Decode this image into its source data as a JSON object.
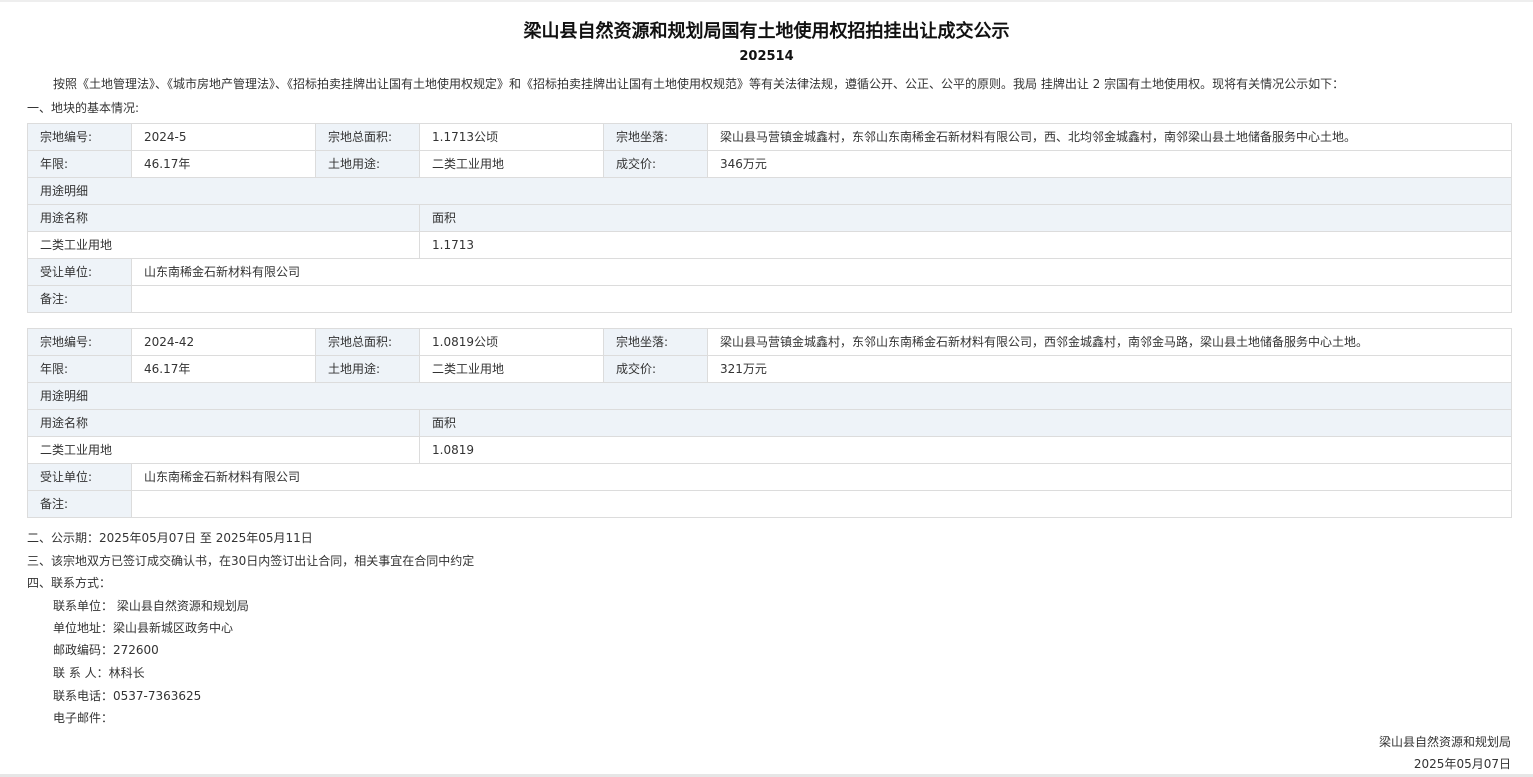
{
  "title": "梁山县自然资源和规划局国有土地使用权招拍挂出让成交公示",
  "number": "202514",
  "intro": "按照《土地管理法》、《城市房地产管理法》、《招标拍卖挂牌出让国有土地使用权规定》和《招标拍卖挂牌出让国有土地使用权规范》等有关法律法规，遵循公开、公正、公平的原则。我局 挂牌出让 2 宗国有土地使用权。现将有关情况公示如下：",
  "section1": "一、地块的基本情况:",
  "labels": {
    "parcel_no": "宗地编号:",
    "total_area": "宗地总面积:",
    "location": "宗地坐落:",
    "term": "年限:",
    "usage": "土地用途:",
    "price": "成交价:",
    "usage_detail": "用途明细",
    "usage_name": "用途名称",
    "area": "面积",
    "transferee": "受让单位:",
    "remarks": "备注:"
  },
  "parcels": [
    {
      "parcel_no": "2024-5",
      "total_area": "1.1713公顷",
      "location": "梁山县马营镇金城鑫村，东邻山东南稀金石新材料有限公司，西、北均邻金城鑫村，南邻梁山县土地储备服务中心土地。",
      "term": "46.17年",
      "usage": "二类工业用地",
      "price": "346万元",
      "detail_usage": "二类工业用地",
      "detail_area": "1.1713",
      "transferee": "山东南稀金石新材料有限公司",
      "remarks": ""
    },
    {
      "parcel_no": "2024-42",
      "total_area": "1.0819公顷",
      "location": "梁山县马营镇金城鑫村，东邻山东南稀金石新材料有限公司，西邻金城鑫村，南邻金马路，梁山县土地储备服务中心土地。",
      "term": "46.17年",
      "usage": "二类工业用地",
      "price": "321万元",
      "detail_usage": "二类工业用地",
      "detail_area": "1.0819",
      "transferee": "山东南稀金石新材料有限公司",
      "remarks": ""
    }
  ],
  "section2": "二、公示期：2025年05月07日 至 2025年05月11日",
  "section3": "三、该宗地双方已签订成交确认书，在30日内签订出让合同，相关事宜在合同中约定",
  "section4": "四、联系方式：",
  "contact": {
    "unit": "联系单位： 梁山县自然资源和规划局",
    "address": "单位地址：梁山县新城区政务中心",
    "postcode": "邮政编码：272600",
    "person": "联 系 人：林科长",
    "phone": "联系电话：0537-7363625",
    "email": "电子邮件："
  },
  "signer": "梁山县自然资源和规划局",
  "date": "2025年05月07日"
}
